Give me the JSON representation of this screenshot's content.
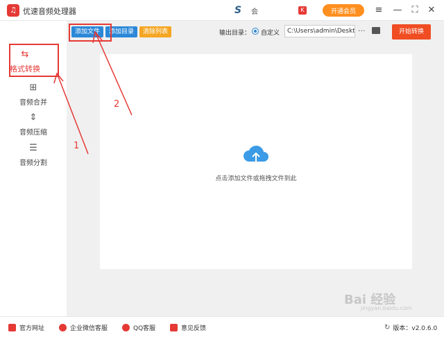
{
  "app": {
    "title": "优速音频处理器",
    "logo_glyph": "♫",
    "user_name": "会",
    "user_badge": "K",
    "vip_label": "开通会员"
  },
  "window_controls": {
    "menu": "≡",
    "minimize": "—",
    "maximize": "⛶",
    "close": "✕"
  },
  "sidebar": {
    "items": [
      {
        "label": "格式转换",
        "icon": "refresh-icon",
        "glyph": "⇆",
        "active": true
      },
      {
        "label": "音频合并",
        "icon": "merge-icon",
        "glyph": "⊞",
        "active": false
      },
      {
        "label": "音频压缩",
        "icon": "compress-icon",
        "glyph": "⇕",
        "active": false
      },
      {
        "label": "音频分割",
        "icon": "split-icon",
        "glyph": "☰",
        "active": false
      }
    ]
  },
  "toolbar": {
    "add_file": "添加文件",
    "add_dir": "添加目录",
    "clear_list": "清除列表"
  },
  "output": {
    "label": "输出目录：",
    "custom_label": "自定义",
    "path": "C:\\Users\\admin\\Deskto",
    "more": "···",
    "start_label": "开始转换"
  },
  "dropzone": {
    "hint": "点击添加文件或拖拽文件到此"
  },
  "annotations": {
    "step1": "1",
    "step2": "2"
  },
  "footer": {
    "links": [
      {
        "label": "官方网址",
        "icon": "website-icon"
      },
      {
        "label": "企业微信客服",
        "icon": "wechat-icon"
      },
      {
        "label": "QQ客服",
        "icon": "qq-icon"
      },
      {
        "label": "意见反馈",
        "icon": "feedback-icon"
      }
    ],
    "version": "版本：v2.0.6.0"
  },
  "watermark": {
    "text": "Bai 经验",
    "sub": "jingyan.baidu.com"
  },
  "colors": {
    "accent": "#2b88d8",
    "red": "#e53935",
    "orange": "#f5a623",
    "start": "#f04d23"
  }
}
